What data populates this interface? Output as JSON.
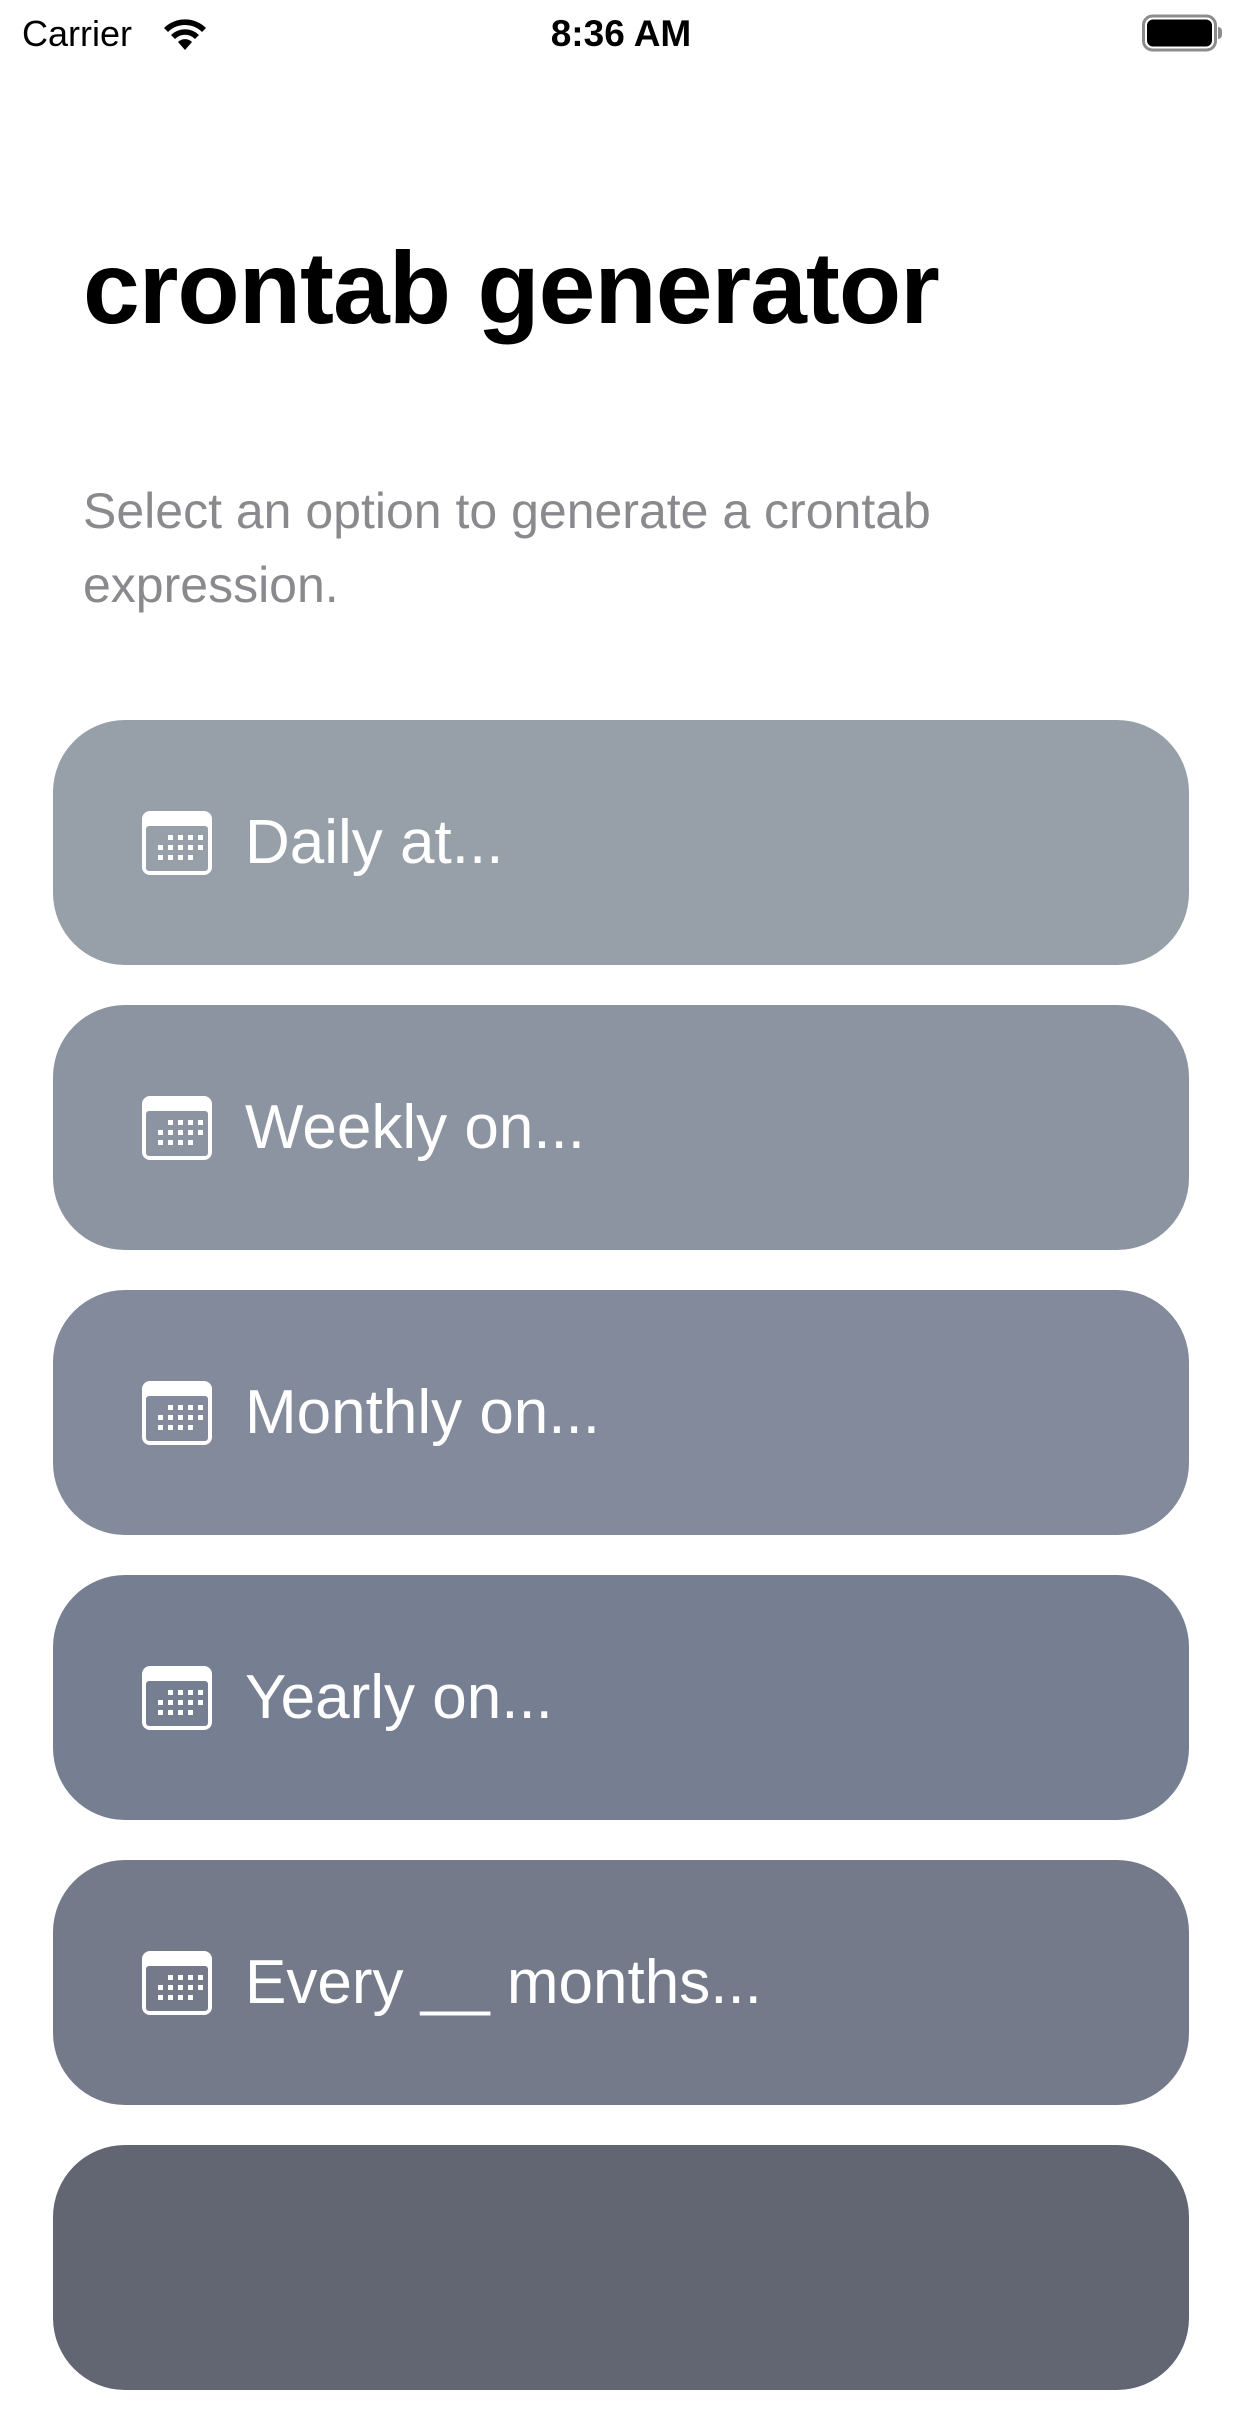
{
  "status_bar": {
    "carrier": "Carrier",
    "time": "8:36 AM",
    "wifi_icon": "wifi-icon",
    "battery_icon": "battery-full-icon"
  },
  "header": {
    "title": "crontab generator",
    "subtitle": "Select an option to generate a crontab expression."
  },
  "options": [
    {
      "label": "Daily at...",
      "icon": "calendar-icon",
      "color": "#979fa9"
    },
    {
      "label": "Weekly on...",
      "icon": "calendar-icon",
      "color": "#8c93a1"
    },
    {
      "label": "Monthly on...",
      "icon": "calendar-icon",
      "color": "#838a9b"
    },
    {
      "label": "Yearly on...",
      "icon": "calendar-icon",
      "color": "#767e92"
    },
    {
      "label": "Every __ months...",
      "icon": "calendar-icon",
      "color": "#757a8b"
    },
    {
      "label": "",
      "icon": "",
      "color": "#626572"
    }
  ]
}
